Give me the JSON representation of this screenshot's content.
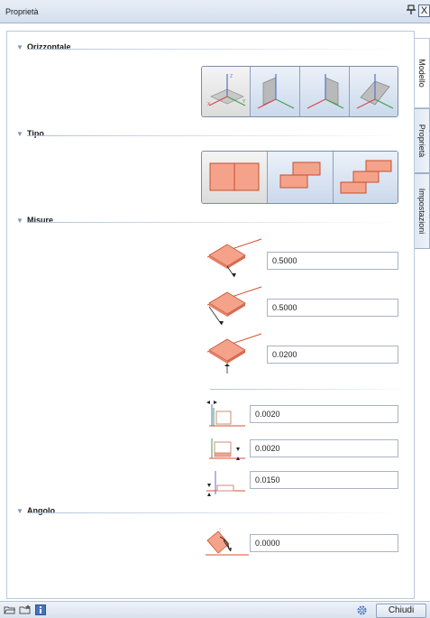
{
  "window": {
    "title": "Proprietà",
    "pin_glyph": "Ȩ",
    "close_glyph": "X"
  },
  "sections": {
    "orizzontale": "Orizzontale",
    "tipo": "Tipo",
    "misure": "Misure",
    "angolo": "Angolo"
  },
  "orizzontale_options": [
    {
      "name": "plane-xy-icon",
      "active": true
    },
    {
      "name": "plane-xz-icon",
      "active": false
    },
    {
      "name": "plane-yz-icon",
      "active": false
    },
    {
      "name": "plane-inclined-icon",
      "active": false
    }
  ],
  "tipo_options": [
    {
      "name": "tile-aligned-icon",
      "active": true
    },
    {
      "name": "tile-offset-icon",
      "active": false
    },
    {
      "name": "tile-stepped-icon",
      "active": false
    }
  ],
  "axis_labels": {
    "x": "X",
    "y": "Y",
    "z": "Z"
  },
  "misure": {
    "length": "0.5000",
    "width": "0.5000",
    "thickness": "0.0200",
    "joint_horizontal": "0.0020",
    "joint_vertical": "0.0020",
    "joint_depth": "0.0150"
  },
  "angolo": {
    "value": "0.0000"
  },
  "tabs": [
    "Modello",
    "Proprietà",
    "Impostazioni"
  ],
  "bottom": {
    "close_label": "Chiudi"
  },
  "colors": {
    "tile_fill": "#f5a28a",
    "tile_edge": "#d9502f",
    "panel_border": "#b9c9dc",
    "button_blue": "#cbd9ec"
  }
}
